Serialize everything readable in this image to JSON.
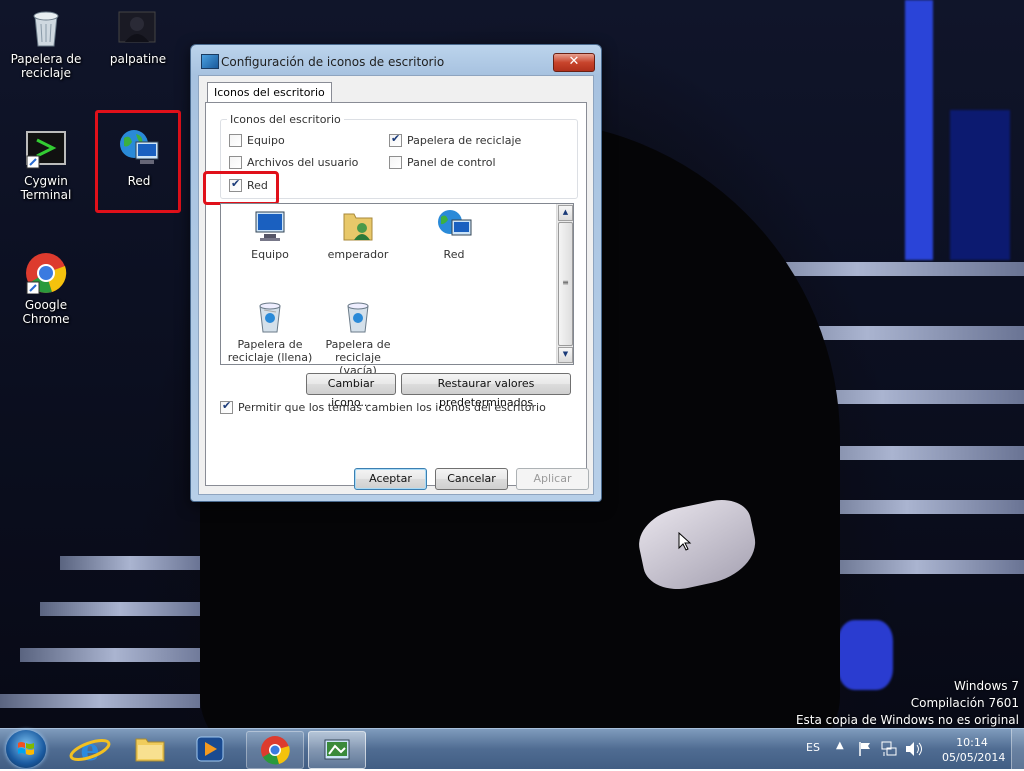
{
  "desktop": {
    "icons": [
      {
        "label": "Papelera de reciclaje",
        "icon": "recycle-bin-icon"
      },
      {
        "label": "palpatine",
        "icon": "user-folder-icon"
      },
      {
        "label": "Cygwin Terminal",
        "icon": "terminal-icon"
      },
      {
        "label": "Red",
        "icon": "network-icon"
      },
      {
        "label": "Google Chrome",
        "icon": "chrome-icon"
      }
    ],
    "watermark": {
      "line1": "Windows 7",
      "line2": "Compilación  7601",
      "line3": "Esta copia de Windows no es original"
    }
  },
  "dialog": {
    "title": "Configuración de iconos de escritorio",
    "close_label": "✕",
    "tab": "Iconos del escritorio",
    "group_label": "Iconos del escritorio",
    "checkboxes": [
      {
        "label": "Equipo",
        "checked": false
      },
      {
        "label": "Papelera de reciclaje",
        "checked": true
      },
      {
        "label": "Archivos del usuario",
        "checked": false
      },
      {
        "label": "Panel de control",
        "checked": false
      },
      {
        "label": "Red",
        "checked": true
      }
    ],
    "list_items": [
      {
        "label": "Equipo",
        "icon": "computer-icon"
      },
      {
        "label": "emperador",
        "icon": "user-folder-icon"
      },
      {
        "label": "Red",
        "icon": "network-icon"
      },
      {
        "label": "Papelera de reciclaje (llena)",
        "icon": "recycle-bin-full-icon"
      },
      {
        "label": "Papelera de reciclaje (vacía)",
        "icon": "recycle-bin-empty-icon"
      }
    ],
    "change_icon_button": "Cambiar icono...",
    "restore_button": "Restaurar valores predeterminados",
    "allow_themes_label": "Permitir que los temas cambien los iconos del escritorio",
    "allow_themes_checked": true,
    "ok_button": "Aceptar",
    "cancel_button": "Cancelar",
    "apply_button": "Aplicar"
  },
  "taskbar": {
    "pinned": [
      "internet-explorer-icon",
      "explorer-icon",
      "media-player-icon",
      "chrome-icon",
      "desktop-icons-dialog-icon"
    ],
    "language": "ES",
    "time": "10:14",
    "date": "05/05/2014"
  },
  "colors": {
    "highlight": "#e0101a",
    "taskbar": "#4a6a98"
  }
}
